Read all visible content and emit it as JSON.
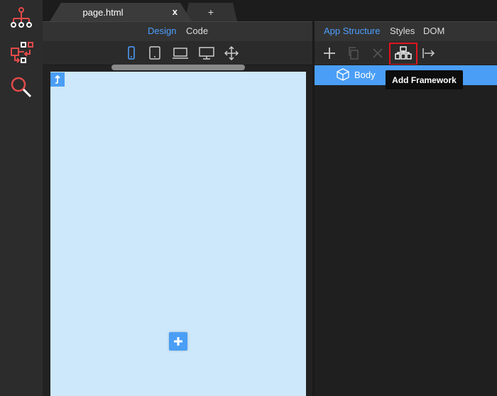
{
  "tabs": {
    "active_title": "page.html",
    "close_label": "x",
    "add_label": "+"
  },
  "editor": {
    "modes": [
      "Design",
      "Code"
    ]
  },
  "panel": {
    "tabs": [
      "App Structure",
      "Styles",
      "DOM"
    ],
    "tree_root": "Body"
  },
  "tooltip": "Add Framework",
  "icons": {
    "left_bar": [
      "tree-icon",
      "transfer-icon",
      "search-icon"
    ],
    "device": [
      "phone-icon",
      "tablet-icon",
      "laptop-icon",
      "desktop-icon",
      "move-icon"
    ],
    "toolbar": [
      "add-icon",
      "copy-icon",
      "delete-icon",
      "framework-icon",
      "export-icon"
    ]
  },
  "colors": {
    "accent": "#4d9fff",
    "icon_red": "#e24a4a",
    "highlight": "#e0141e",
    "canvas": "#cce8fa"
  }
}
